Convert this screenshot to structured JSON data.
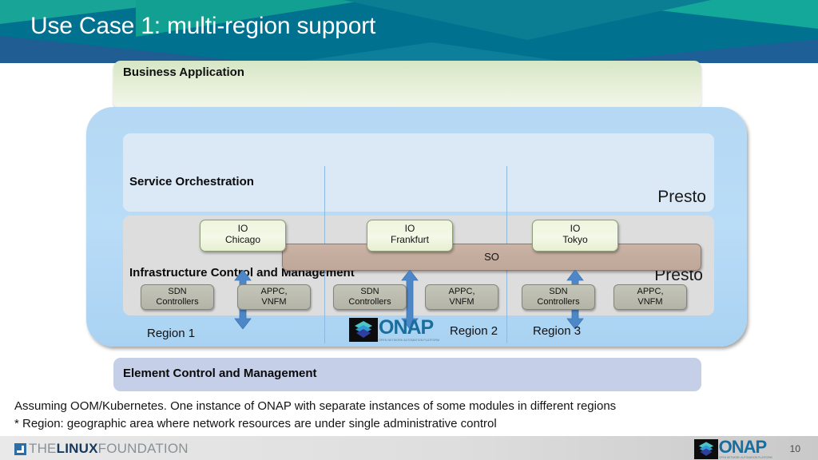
{
  "header": {
    "title": "Use Case 1: multi-region support",
    "bg_color": "#00718f",
    "accent_color": "#14a89a"
  },
  "business_application": {
    "label": "Business Application",
    "color": "#dfecd0"
  },
  "onap_panel": {
    "color": "#b5d8f4",
    "service_orchestration": {
      "label": "Service Orchestration",
      "presto_label": "Presto",
      "so_box_label": "SO",
      "band_color": "#dbe9f7",
      "so_box_color": "#c3ac9d"
    },
    "infrastructure": {
      "label": "Infrastructure Control and Management",
      "presto_label": "Presto",
      "band_color": "#dddddd"
    },
    "columns": [
      {
        "region_label": "Region 1",
        "io": {
          "line1": "IO",
          "line2": "Chicago"
        },
        "boxes": [
          {
            "line1": "SDN",
            "line2": "Controllers"
          },
          {
            "line1": "APPC,",
            "line2": "VNFM"
          }
        ]
      },
      {
        "region_label": "Region 2",
        "io": {
          "line1": "IO",
          "line2": "Frankfurt"
        },
        "boxes": [
          {
            "line1": "SDN",
            "line2": "Controllers"
          },
          {
            "line1": "APPC,",
            "line2": "VNFM"
          }
        ]
      },
      {
        "region_label": "Region 3",
        "io": {
          "line1": "IO",
          "line2": "Tokyo"
        },
        "boxes": [
          {
            "line1": "SDN",
            "line2": "Controllers"
          },
          {
            "line1": "APPC,",
            "line2": "VNFM"
          }
        ]
      }
    ],
    "inline_logo": {
      "word": "ONAP",
      "tagline": "OPEN NETWORK AUTOMATION PLATFORM"
    }
  },
  "element_control": {
    "label": "Element Control and Management",
    "color": "#c5cfe8"
  },
  "notes": [
    "Assuming OOM/Kubernetes.  One instance of ONAP with separate instances of some modules in different regions",
    "* Region: geographic area where network resources are under single administrative control"
  ],
  "footer": {
    "linux_foundation": {
      "the": "THE",
      "linux": "LINUX",
      "foundation": "FOUNDATION"
    },
    "onap": {
      "word": "ONAP",
      "tagline": "OPEN NETWORK AUTOMATION PLATFORM"
    },
    "page_number": "10"
  }
}
